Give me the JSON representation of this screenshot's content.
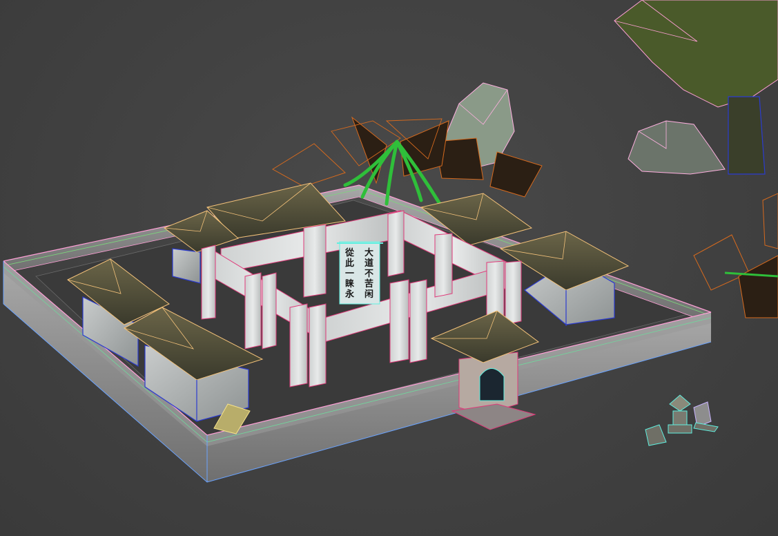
{
  "viewport": {
    "background": "#444444",
    "wire_colors": {
      "wall": "#c8c8c8",
      "wall_top": "#ff9fd6",
      "roof": "#f4c27a",
      "hall": "#2b3bd1",
      "cloth": "#e03a7a",
      "tree": "#d66a1e",
      "rock": "#ffb0e0",
      "lantern": "#5ff0e0"
    }
  },
  "gate_banner": {
    "left_column": [
      "從",
      "此",
      "一",
      "睐",
      "永"
    ],
    "right_column": [
      "大",
      "道",
      "不",
      "苦",
      "闲"
    ]
  }
}
